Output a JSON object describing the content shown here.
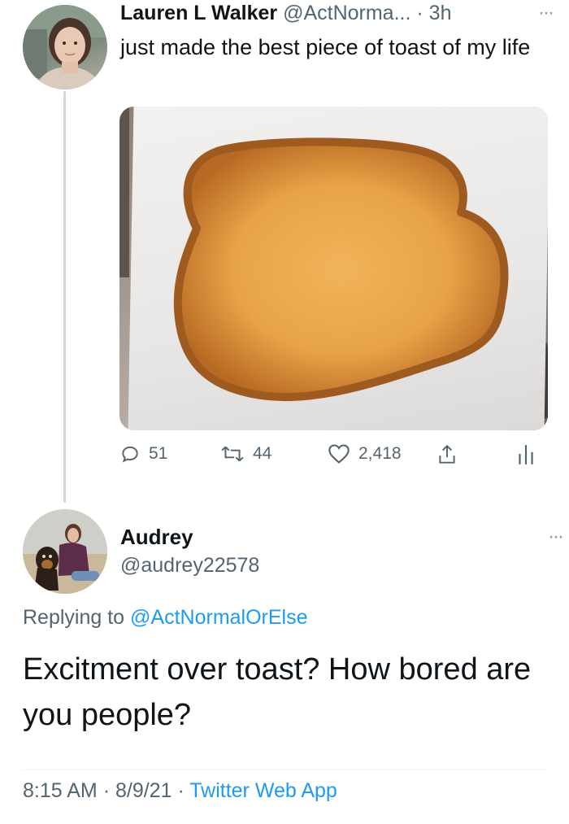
{
  "tweet": {
    "author_name": "Lauren L Walker",
    "author_handle": "@ActNorma...",
    "separator": "·",
    "time": "3h",
    "more": "···",
    "text": "just made the best piece of toast of my life",
    "stats": {
      "replies": "51",
      "retweets": "44",
      "likes": "2,418"
    }
  },
  "reply": {
    "author_name": "Audrey",
    "author_handle": "@audrey22578",
    "more": "···",
    "replying_prefix": "Replying to",
    "replying_to": "@ActNormalOrElse",
    "text": "Excitment over toast? How bored are you people?",
    "meta": {
      "time": "8:15 AM",
      "sep1": "·",
      "date": "8/9/21",
      "sep2": "·",
      "source": "Twitter Web App"
    }
  },
  "icons": [
    "reply-icon",
    "retweet-icon",
    "like-icon",
    "share-icon",
    "analytics-icon",
    "more-icon"
  ],
  "colors": {
    "accent": "#1d9bf0",
    "secondary_text": "#536471",
    "primary_text": "#0f1419",
    "thread_line": "#cfd9de"
  }
}
